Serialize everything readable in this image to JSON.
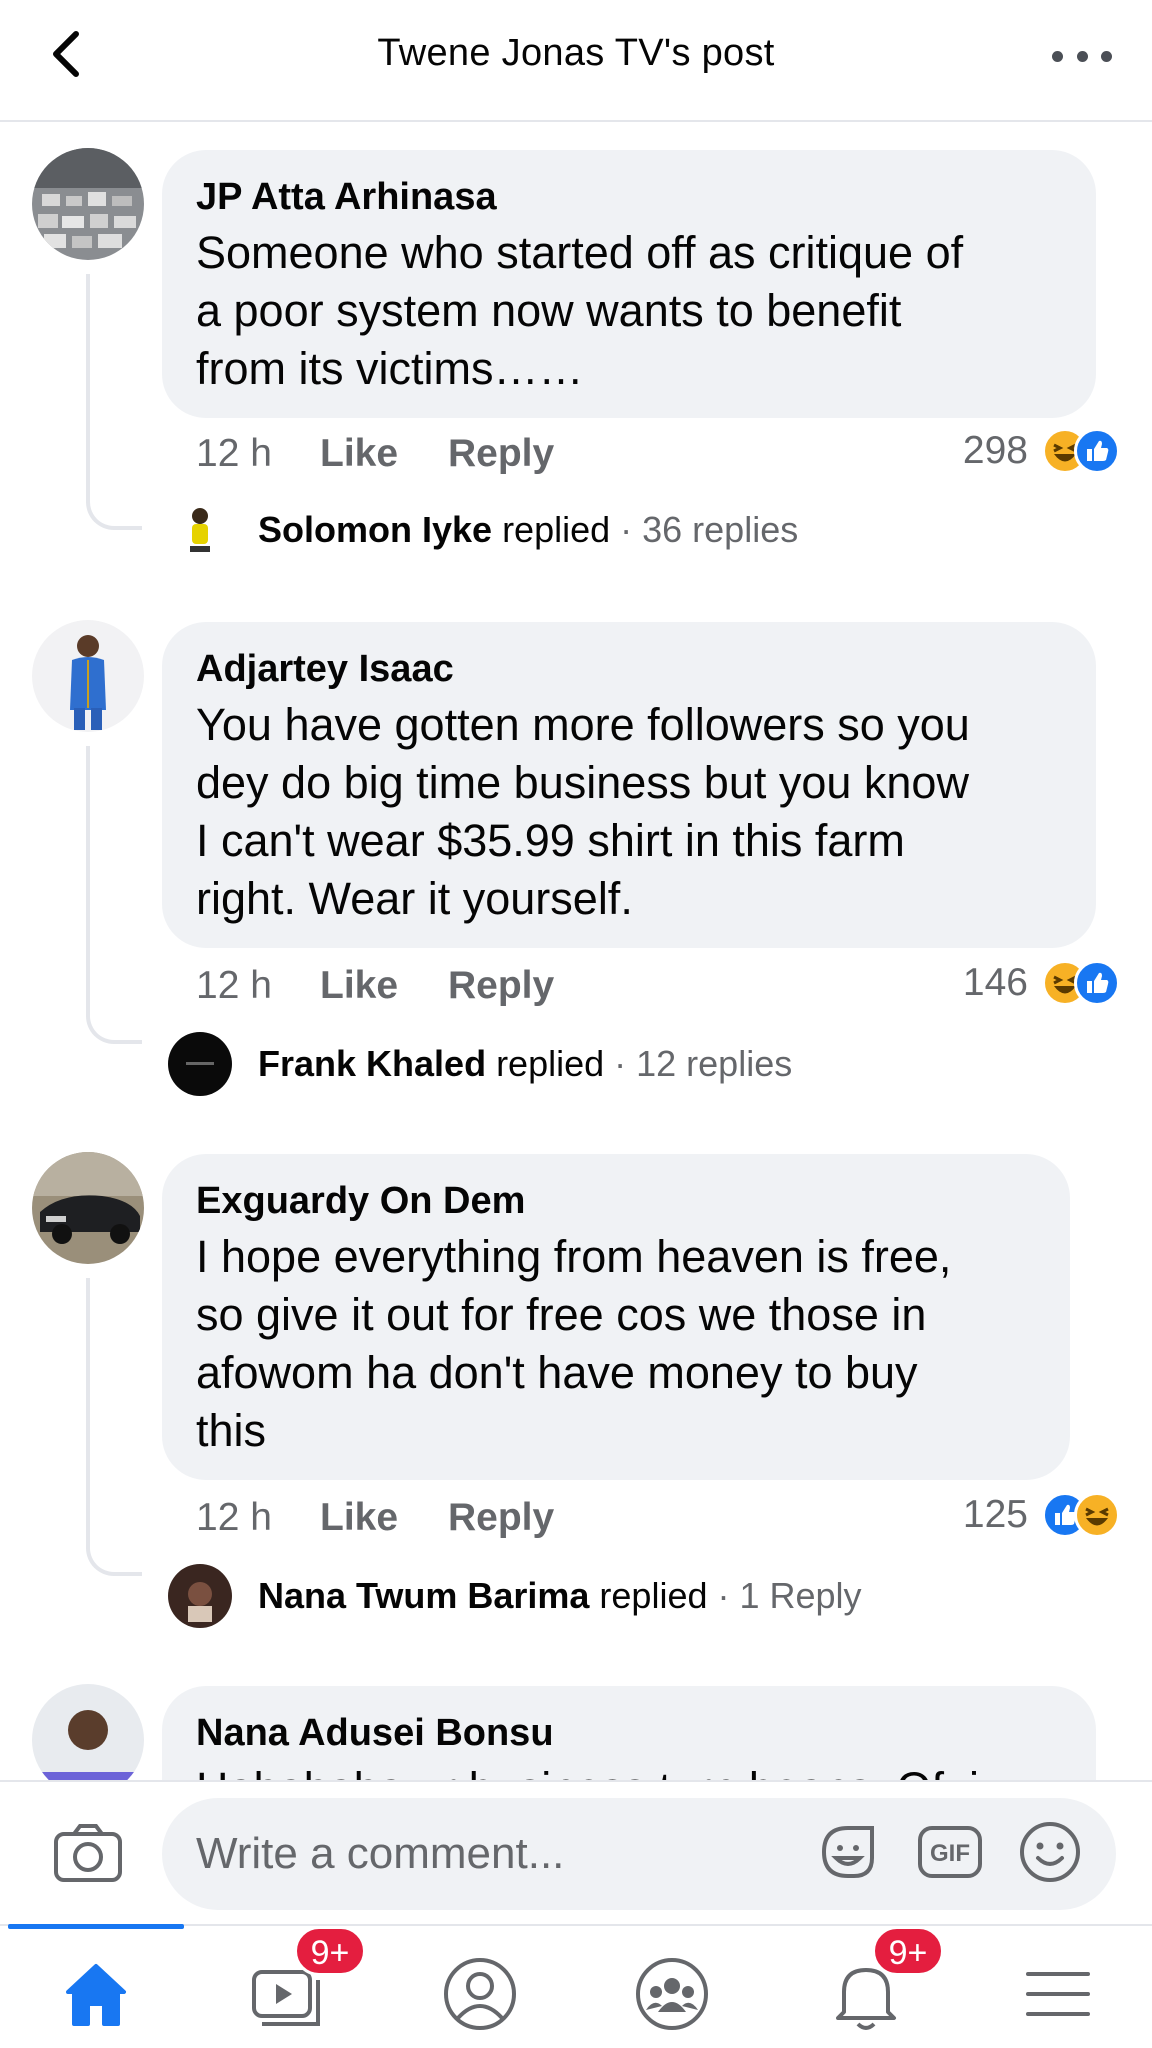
{
  "header": {
    "title": "Twene Jonas TV's post"
  },
  "comments": [
    {
      "author": "JP Atta Arhinasa",
      "text_lines": [
        "Someone who started off as critique of",
        "a poor system now wants to benefit",
        "from its victims……"
      ],
      "time": "12 h",
      "like_label": "Like",
      "reply_label": "Reply",
      "reaction_count": "298",
      "reactions": [
        "haha",
        "like"
      ],
      "replied_by": "Solomon Iyke",
      "replied_verb": "replied",
      "reply_count": "· 36 replies"
    },
    {
      "author": "Adjartey Isaac",
      "text_lines": [
        "You have gotten more followers so you",
        "dey do big time business but you know",
        "I can't wear $35.99 shirt in this farm",
        "right. Wear it yourself."
      ],
      "time": "12 h",
      "like_label": "Like",
      "reply_label": "Reply",
      "reaction_count": "146",
      "reactions": [
        "haha",
        "like"
      ],
      "replied_by": "Frank Khaled",
      "replied_verb": "replied",
      "reply_count": "· 12 replies"
    },
    {
      "author": "Exguardy On Dem",
      "text_lines": [
        "I hope everything from heaven is free,",
        "so give it out for free cos we those in",
        "afowom ha don't have money to buy",
        "this"
      ],
      "time": "12 h",
      "like_label": "Like",
      "reply_label": "Reply",
      "reaction_count": "125",
      "reactions": [
        "like",
        "haha"
      ],
      "replied_by": "Nana Twum Barima",
      "replied_verb": "replied",
      "reply_count": "· 1 Reply"
    },
    {
      "author": "Nana Adusei Bonsu",
      "text_lines": [
        "Hahahaha ur business turn beans. Ofui"
      ]
    }
  ],
  "composer": {
    "placeholder": "Write a comment...",
    "gif_label": "GIF"
  },
  "tabbar": {
    "items": [
      "home-icon",
      "watch-icon",
      "profile-icon",
      "groups-icon",
      "notifications-icon",
      "menu-icon"
    ],
    "watch_badge": "9+",
    "notifications_badge": "9+",
    "active": "home",
    "accent_color": "#1877f2",
    "badge_color": "#e41e3f"
  }
}
